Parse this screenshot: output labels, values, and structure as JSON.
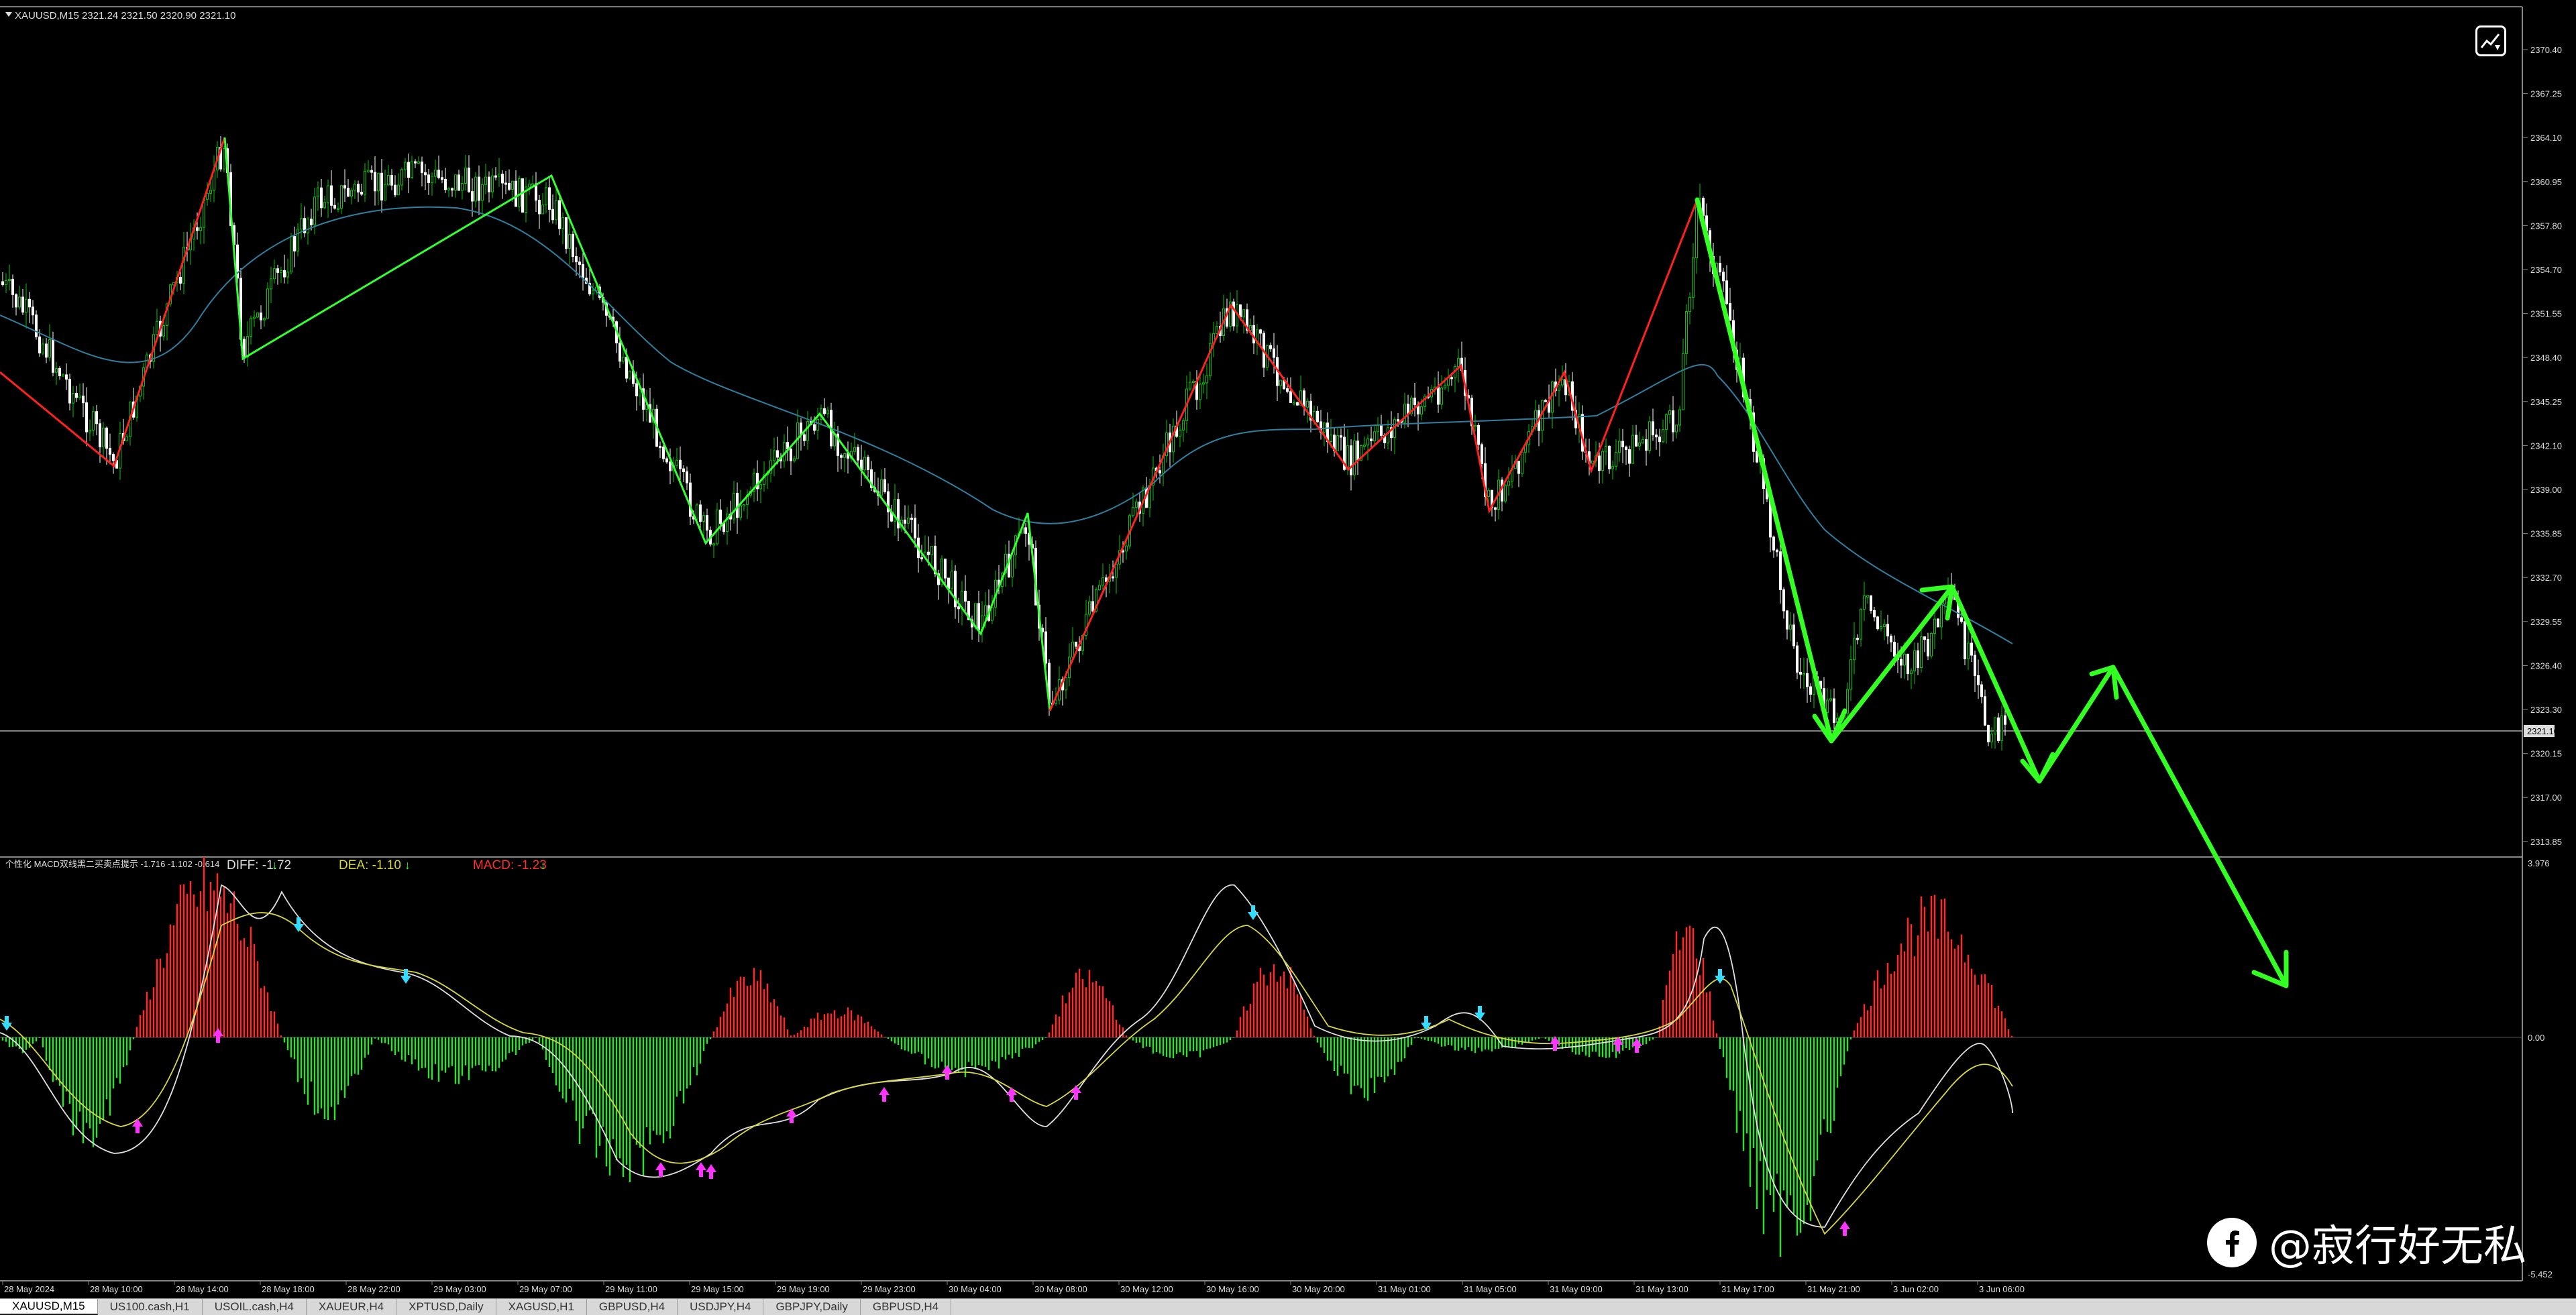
{
  "symbol_header": {
    "text": "XAUUSD,M15  2321.24 2321.50 2320.90 2321.10"
  },
  "price_axis": {
    "labels": [
      "2370.40",
      "2367.25",
      "2364.10",
      "2360.95",
      "2357.80",
      "2354.70",
      "2351.55",
      "2348.40",
      "2345.25",
      "2342.10",
      "2339.00",
      "2335.85",
      "2332.70",
      "2329.55",
      "2326.40",
      "2323.30",
      "2320.15",
      "2317.00",
      "2313.85"
    ],
    "current_price": "2321.10"
  },
  "indicator": {
    "name_label": "个性化 MACD双线黑二买卖点提示 -1.716 -1.102 -0.614",
    "diff_label": "DIFF: -1.72",
    "dea_label": "DEA: -1.10",
    "macd_label": "MACD: -1.23",
    "axis_top": "3.976",
    "axis_zero": "0.00",
    "axis_bottom": "-5.452"
  },
  "time_axis": {
    "labels": [
      "28 May 2024",
      "28 May 10:00",
      "28 May 14:00",
      "28 May 18:00",
      "28 May 22:00",
      "29 May 03:00",
      "29 May 07:00",
      "29 May 11:00",
      "29 May 15:00",
      "29 May 19:00",
      "29 May 23:00",
      "30 May 04:00",
      "30 May 08:00",
      "30 May 12:00",
      "30 May 16:00",
      "30 May 20:00",
      "31 May 01:00",
      "31 May 05:00",
      "31 May 09:00",
      "31 May 13:00",
      "31 May 17:00",
      "31 May 21:00",
      "3 Jun 02:00",
      "3 Jun 06:00"
    ]
  },
  "tabs": [
    {
      "label": "XAUUSD,M15",
      "active": true
    },
    {
      "label": "US100.cash,H1",
      "active": false
    },
    {
      "label": "USOIL.cash,H4",
      "active": false
    },
    {
      "label": "XAUEUR,H4",
      "active": false
    },
    {
      "label": "XPTUSD,Daily",
      "active": false
    },
    {
      "label": "XAGUSD,H1",
      "active": false
    },
    {
      "label": "GBPUSD,H4",
      "active": false
    },
    {
      "label": "USDJPY,H4",
      "active": false
    },
    {
      "label": "GBPJPY,Daily",
      "active": false
    },
    {
      "label": "GBPUSD,H4",
      "active": false
    }
  ],
  "watermark": {
    "icon": "facebook-icon",
    "text": "@寂行好无私"
  },
  "colors": {
    "background": "#000000",
    "bull_candle": "#00c800",
    "bear_candle": "#ffffff",
    "zigzag_up": "#ff2020",
    "zigzag_down": "#33ff33",
    "moving_average": "#2f7f9f",
    "forecast_arrow": "#33ff22",
    "histogram_positive": "#ff2a2a",
    "histogram_negative": "#33dd33",
    "diff_line": "#e0e0e0",
    "dea_line": "#d8d840",
    "buy_marker": "#ff33ff",
    "sell_marker": "#33ddff"
  }
}
